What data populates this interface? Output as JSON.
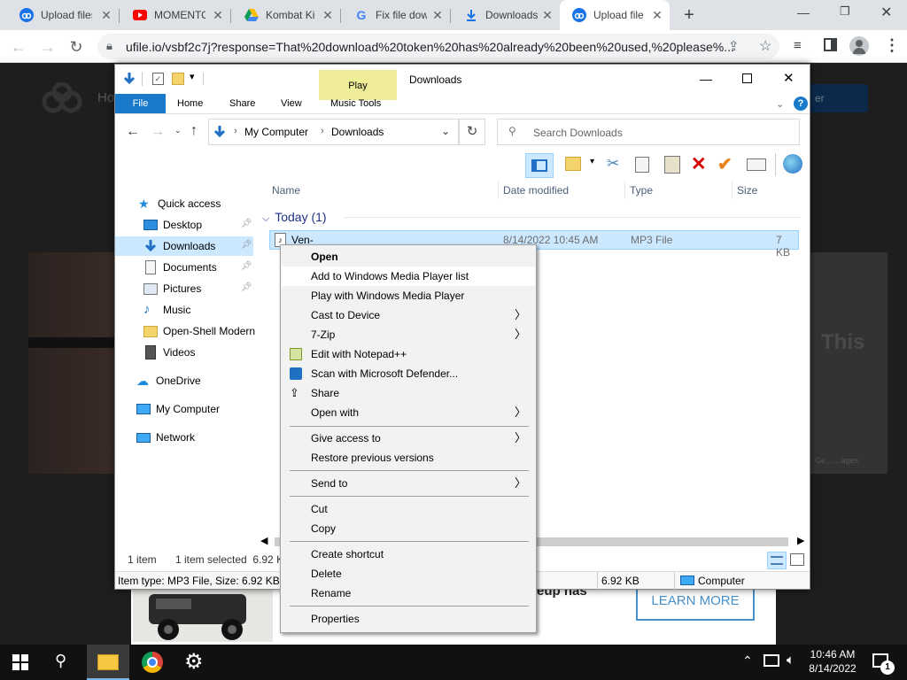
{
  "browser": {
    "tabs": [
      {
        "title": "Upload files",
        "icon": "ufile-icon",
        "active": false
      },
      {
        "title": "MOMENTO",
        "icon": "youtube-icon",
        "active": false
      },
      {
        "title": "Kombat Ki",
        "icon": "drive-icon",
        "active": false
      },
      {
        "title": "Fix file dow",
        "icon": "google-icon",
        "active": false
      },
      {
        "title": "Downloads",
        "icon": "download-icon",
        "active": false
      },
      {
        "title": "Upload file",
        "icon": "ufile-icon",
        "active": true
      }
    ],
    "url": "ufile.io/vsbf2c7j?response=That%20download%20token%20has%20already%20been%20used,%20please%..."
  },
  "webpage": {
    "nav_fragment": "Ho",
    "signup_fragment": "er",
    "headline_fragment": "This",
    "ad_text_fragment": "eup has",
    "ad_button": "LEARN MORE",
    "image_credit": "Ge... ...ages"
  },
  "explorer": {
    "title": "Downloads",
    "ribbon": {
      "play_tab": "Play",
      "tabs": [
        "File",
        "Home",
        "Share",
        "View",
        "Music Tools"
      ]
    },
    "address": {
      "parts": [
        "My Computer",
        "Downloads"
      ]
    },
    "search_placeholder": "Search Downloads",
    "nav_pane": [
      {
        "label": "Quick access",
        "icon": "star-icon",
        "pinned": false,
        "indent": 0
      },
      {
        "label": "Desktop",
        "icon": "desktop-icon",
        "pinned": true,
        "indent": 1
      },
      {
        "label": "Downloads",
        "icon": "download-arrow-icon",
        "pinned": true,
        "indent": 1,
        "selected": true
      },
      {
        "label": "Documents",
        "icon": "documents-icon",
        "pinned": true,
        "indent": 1
      },
      {
        "label": "Pictures",
        "icon": "pictures-icon",
        "pinned": true,
        "indent": 1
      },
      {
        "label": "Music",
        "icon": "music-icon",
        "pinned": false,
        "indent": 1
      },
      {
        "label": "Open-Shell Modern",
        "icon": "folder-icon",
        "pinned": false,
        "indent": 1
      },
      {
        "label": "Videos",
        "icon": "videos-icon",
        "pinned": false,
        "indent": 1
      },
      {
        "label": "OneDrive",
        "icon": "onedrive-icon",
        "pinned": false,
        "indent": 0
      },
      {
        "label": "My Computer",
        "icon": "computer-icon",
        "pinned": false,
        "indent": 0
      },
      {
        "label": "Network",
        "icon": "network-icon",
        "pinned": false,
        "indent": 0
      }
    ],
    "columns": [
      "Name",
      "Date modified",
      "Type",
      "Size"
    ],
    "group": "Today (1)",
    "file": {
      "name": "Ven-",
      "date": "8/14/2022 10:45 AM",
      "type": "MP3 File",
      "size": "7 KB"
    },
    "status": {
      "count": "1 item",
      "selected": "1 item selected  6.92 K",
      "details": "Item type: MP3 File, Size: 6.92 KB, L",
      "size": "6.92 KB",
      "location": "Computer"
    }
  },
  "context_menu": {
    "items": [
      {
        "label": "Open",
        "bold": true
      },
      {
        "label": "Add to Windows Media Player list",
        "highlight": true
      },
      {
        "label": "Play with Windows Media Player"
      },
      {
        "label": "Cast to Device",
        "submenu": true
      },
      {
        "label": "7-Zip",
        "submenu": true
      },
      {
        "label": "Edit with Notepad++",
        "icon": "notepadpp-icon"
      },
      {
        "label": "Scan with Microsoft Defender...",
        "icon": "defender-icon"
      },
      {
        "label": "Share",
        "icon": "share-icon"
      },
      {
        "label": "Open with",
        "submenu": true
      },
      {
        "separator": true
      },
      {
        "label": "Give access to",
        "submenu": true
      },
      {
        "label": "Restore previous versions"
      },
      {
        "separator": true
      },
      {
        "label": "Send to",
        "submenu": true
      },
      {
        "separator": true
      },
      {
        "label": "Cut"
      },
      {
        "label": "Copy"
      },
      {
        "separator": true
      },
      {
        "label": "Create shortcut"
      },
      {
        "label": "Delete"
      },
      {
        "label": "Rename"
      },
      {
        "separator": true
      },
      {
        "label": "Properties"
      }
    ]
  },
  "taskbar": {
    "time": "10:46 AM",
    "date": "8/14/2022",
    "notification_count": "1"
  }
}
